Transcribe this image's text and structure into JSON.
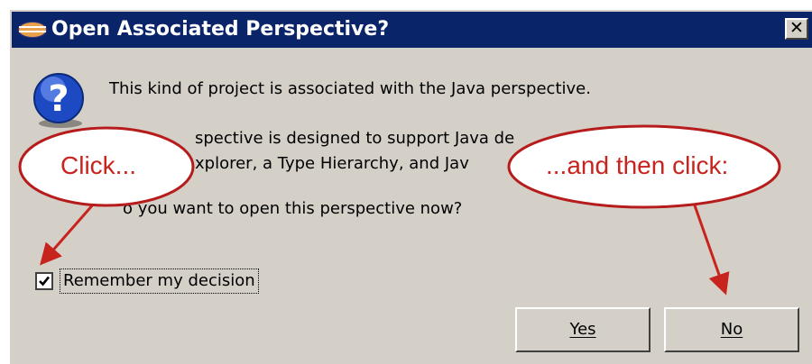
{
  "dialog": {
    "title": "Open Associated Perspective?",
    "close_label": "✕",
    "icons": {
      "title": "eclipse-icon",
      "message": "question-icon"
    },
    "message_line1": "This kind of project is associated with the Java perspective.",
    "message_line2": "spective is designed to support Java de",
    "message_line3": "xplorer, a Type Hierarchy, and Jav",
    "message_line4": "o you want to open this perspective now?",
    "remember_label": "Remember my decision",
    "remember_checked": true,
    "yes_label": "Yes",
    "no_label": "No"
  },
  "annotations": {
    "callout_left": "Click...",
    "callout_right": "...and then click:",
    "color": "#c8241e"
  }
}
